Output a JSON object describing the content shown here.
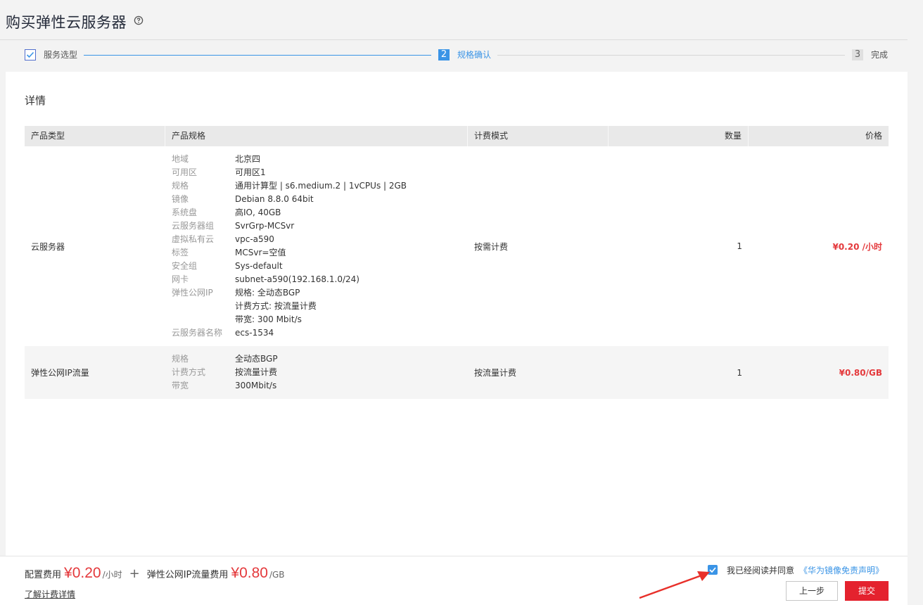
{
  "header": {
    "title": "购买弹性云服务器"
  },
  "steps": [
    {
      "number": "",
      "label": "服务选型"
    },
    {
      "number": "2",
      "label": "规格确认"
    },
    {
      "number": "3",
      "label": "完成"
    }
  ],
  "details": {
    "title": "详情",
    "columns": {
      "type": "产品类型",
      "spec": "产品规格",
      "mode": "计费模式",
      "qty": "数量",
      "price": "价格"
    },
    "rows": [
      {
        "type": "云服务器",
        "specs": [
          {
            "key": "地域",
            "value": "北京四"
          },
          {
            "key": "可用区",
            "value": "可用区1"
          },
          {
            "key": "规格",
            "value": "通用计算型 | s6.medium.2 | 1vCPUs | 2GB"
          },
          {
            "key": "镜像",
            "value": "Debian 8.8.0 64bit"
          },
          {
            "key": "系统盘",
            "value": "高IO, 40GB"
          },
          {
            "key": "云服务器组",
            "value": "SvrGrp-MCSvr"
          },
          {
            "key": "虚拟私有云",
            "value": "vpc-a590"
          },
          {
            "key": "标签",
            "value": "MCSvr=空值"
          },
          {
            "key": "安全组",
            "value": "Sys-default"
          },
          {
            "key": "网卡",
            "value": "subnet-a590(192.168.1.0/24)"
          },
          {
            "key": "弹性公网IP",
            "value": "规格: 全动态BGP"
          },
          {
            "key": "",
            "value": "计费方式: 按流量计费"
          },
          {
            "key": "",
            "value": "带宽: 300 Mbit/s"
          },
          {
            "key": "云服务器名称",
            "value": "ecs-1534"
          }
        ],
        "mode": "按需计费",
        "qty": "1",
        "price": "¥0.20 /小时"
      },
      {
        "type": "弹性公网IP流量",
        "specs": [
          {
            "key": "规格",
            "value": "全动态BGP"
          },
          {
            "key": "计费方式",
            "value": "按流量计费"
          },
          {
            "key": "带宽",
            "value": "300Mbit/s"
          }
        ],
        "mode": "按流量计费",
        "qty": "1",
        "price": "¥0.80/GB"
      }
    ]
  },
  "footer": {
    "config_fee_label": "配置费用",
    "config_fee_amount": "¥0.20",
    "config_fee_unit": "/小时",
    "plus": "+",
    "eip_fee_label": "弹性公网IP流量费用",
    "eip_fee_amount": "¥0.80",
    "eip_fee_unit": "/GB",
    "billing_link": "了解计费详情",
    "agree_text": "我已经阅读并同意",
    "agree_link": "《华为镜像免责声明》",
    "prev_button": "上一步",
    "submit_button": "提交"
  },
  "colors": {
    "accent": "#3a94e6",
    "price": "#e4393c",
    "submit": "#e4222e"
  }
}
